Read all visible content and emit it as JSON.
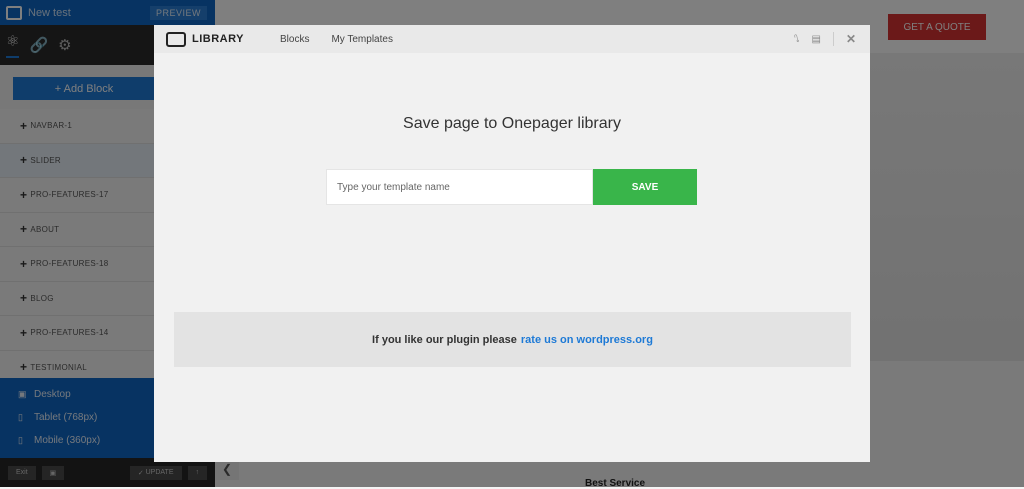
{
  "sidebar": {
    "title": "New test",
    "preview_label": "PREVIEW",
    "add_block_label": "+ Add Block",
    "blocks": [
      "NAVBAR-1",
      "SLIDER",
      "PRO-FEATURES-17",
      "ABOUT",
      "PRO-FEATURES-18",
      "BLOG",
      "PRO-FEATURES-14",
      "TESTIMONIAL"
    ],
    "devices": [
      {
        "label": "Desktop",
        "icon": "desktop-icon"
      },
      {
        "label": "Tablet (768px)",
        "icon": "tablet-icon"
      },
      {
        "label": "Mobile (360px)",
        "icon": "mobile-icon"
      }
    ],
    "exit_label": "Exit",
    "update_label": "UPDATE"
  },
  "page": {
    "quote_label": "GET A QUOTE",
    "best_service": "Best Service"
  },
  "modal": {
    "title": "LIBRARY",
    "tabs": [
      "Blocks",
      "My Templates"
    ],
    "heading": "Save page to Onepager library",
    "input_placeholder": "Type your template name",
    "save_label": "SAVE",
    "rate_text": "If you like our plugin please",
    "rate_link": "rate us on wordpress.org"
  }
}
